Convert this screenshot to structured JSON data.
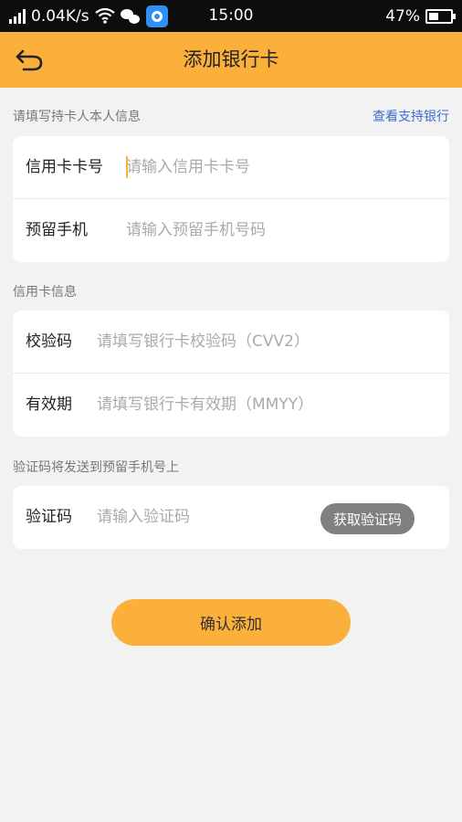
{
  "status_bar": {
    "network_speed": "0.04K/s",
    "time": "15:00",
    "battery": "47%",
    "battery_level": 0.47
  },
  "header": {
    "title": "添加银行卡"
  },
  "holder_section": {
    "label": "请填写持卡人本人信息",
    "support_link": "查看支持银行",
    "card_number": {
      "label": "信用卡卡号",
      "placeholder": "请输入信用卡卡号",
      "value": ""
    },
    "phone": {
      "label": "预留手机",
      "placeholder": "请输入预留手机号码",
      "value": ""
    }
  },
  "card_section": {
    "label": "信用卡信息",
    "cvv": {
      "label": "校验码",
      "placeholder": "请填写银行卡校验码（CVV2）",
      "value": ""
    },
    "expiry": {
      "label": "有效期",
      "placeholder": "请填写银行卡有效期（MMYY）",
      "value": ""
    }
  },
  "verify_section": {
    "label": "验证码将发送到预留手机号上",
    "code": {
      "label": "验证码",
      "placeholder": "请输入验证码",
      "value": "",
      "get_code_label": "获取验证码"
    }
  },
  "actions": {
    "confirm_label": "确认添加"
  },
  "colors": {
    "accent": "#fbb03b",
    "link": "#3a6ccf",
    "disabled_button": "#808080"
  }
}
